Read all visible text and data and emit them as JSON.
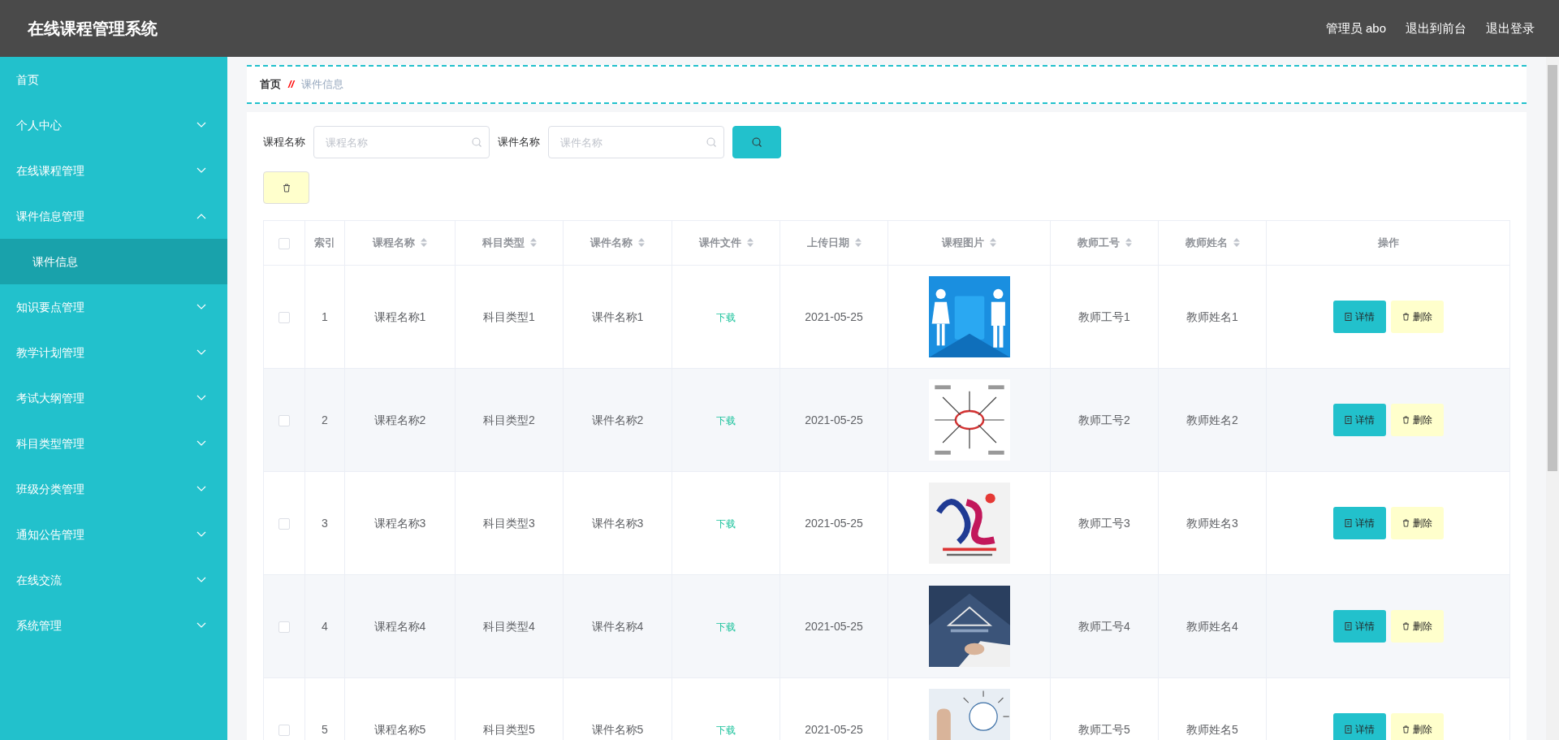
{
  "header": {
    "title": "在线课程管理系统",
    "links": [
      "管理员 abo",
      "退出到前台",
      "退出登录"
    ]
  },
  "sidebar": {
    "items": [
      {
        "label": "首页",
        "kind": "link",
        "selected": false
      },
      {
        "label": "个人中心",
        "kind": "menu",
        "expanded": false,
        "selected": false
      },
      {
        "label": "在线课程管理",
        "kind": "menu",
        "expanded": false,
        "selected": false
      },
      {
        "label": "课件信息管理",
        "kind": "menu",
        "expanded": true,
        "selected": false,
        "children": [
          {
            "label": "课件信息",
            "selected": true
          }
        ]
      },
      {
        "label": "知识要点管理",
        "kind": "menu",
        "expanded": false,
        "selected": false
      },
      {
        "label": "教学计划管理",
        "kind": "menu",
        "expanded": false,
        "selected": false
      },
      {
        "label": "考试大纲管理",
        "kind": "menu",
        "expanded": false,
        "selected": false
      },
      {
        "label": "科目类型管理",
        "kind": "menu",
        "expanded": false,
        "selected": false
      },
      {
        "label": "班级分类管理",
        "kind": "menu",
        "expanded": false,
        "selected": false
      },
      {
        "label": "通知公告管理",
        "kind": "menu",
        "expanded": false,
        "selected": false
      },
      {
        "label": "在线交流",
        "kind": "menu",
        "expanded": false,
        "selected": false
      },
      {
        "label": "系统管理",
        "kind": "menu",
        "expanded": false,
        "selected": false
      }
    ]
  },
  "breadcrumb": {
    "items": [
      "首页",
      "课件信息"
    ],
    "separator": "//"
  },
  "search": {
    "fields": [
      {
        "label": "课程名称",
        "placeholder": "课程名称"
      },
      {
        "label": "课件名称",
        "placeholder": "课件名称"
      }
    ]
  },
  "table": {
    "header_checked": false,
    "columns": [
      {
        "label": "索引",
        "sortable": false
      },
      {
        "label": "课程名称",
        "sortable": true
      },
      {
        "label": "科目类型",
        "sortable": true
      },
      {
        "label": "课件名称",
        "sortable": true
      },
      {
        "label": "课件文件",
        "sortable": true
      },
      {
        "label": "上传日期",
        "sortable": true
      },
      {
        "label": "课程图片",
        "sortable": true
      },
      {
        "label": "教师工号",
        "sortable": true
      },
      {
        "label": "教师姓名",
        "sortable": true
      },
      {
        "label": "操作",
        "sortable": false
      }
    ],
    "rows": [
      {
        "checked": false,
        "index": "1",
        "course": "课程名称1",
        "subject": "科目类型1",
        "courseware": "课件名称1",
        "file": "下载",
        "date": "2021-05-25",
        "image": {
          "kind": "picture"
        },
        "teacher_id": "教师工号1",
        "teacher_name": "教师姓名1",
        "actions": [
          "详情",
          "删除"
        ]
      },
      {
        "checked": false,
        "index": "2",
        "course": "课程名称2",
        "subject": "科目类型2",
        "courseware": "课件名称2",
        "file": "下载",
        "date": "2021-05-25",
        "image": {
          "kind": "picture"
        },
        "teacher_id": "教师工号2",
        "teacher_name": "教师姓名2",
        "actions": [
          "详情",
          "删除"
        ]
      },
      {
        "checked": false,
        "index": "3",
        "course": "课程名称3",
        "subject": "科目类型3",
        "courseware": "课件名称3",
        "file": "下载",
        "date": "2021-05-25",
        "image": {
          "kind": "picture"
        },
        "teacher_id": "教师工号3",
        "teacher_name": "教师姓名3",
        "actions": [
          "详情",
          "删除"
        ]
      },
      {
        "checked": false,
        "index": "4",
        "course": "课程名称4",
        "subject": "科目类型4",
        "courseware": "课件名称4",
        "file": "下载",
        "date": "2021-05-25",
        "image": {
          "kind": "picture"
        },
        "teacher_id": "教师工号4",
        "teacher_name": "教师姓名4",
        "actions": [
          "详情",
          "删除"
        ]
      },
      {
        "checked": false,
        "index": "5",
        "course": "课程名称5",
        "subject": "科目类型5",
        "courseware": "课件名称5",
        "file": "下载",
        "date": "2021-05-25",
        "image": {
          "kind": "picture"
        },
        "teacher_id": "教师工号5",
        "teacher_name": "教师姓名5",
        "actions": [
          "详情",
          "删除"
        ]
      }
    ]
  }
}
